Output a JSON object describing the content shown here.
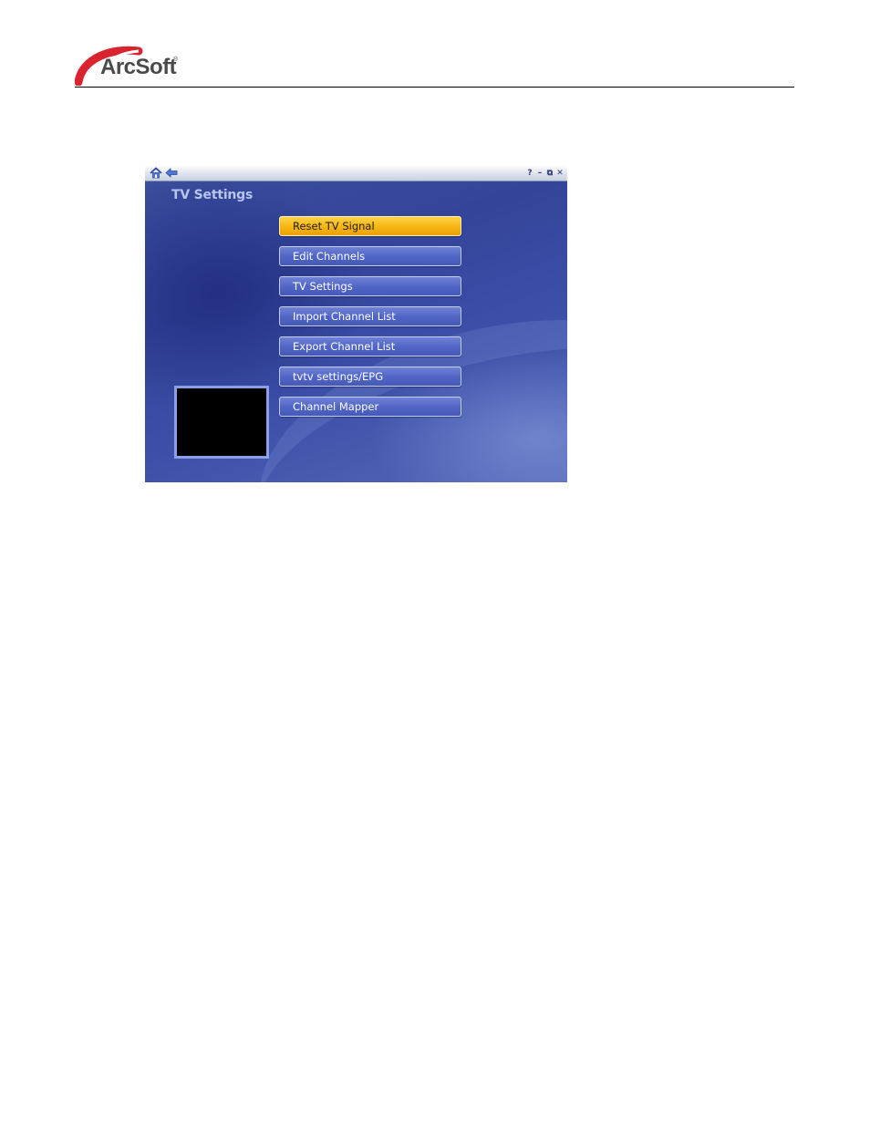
{
  "document": {
    "logo": {
      "text": "ArcSoft",
      "registered_mark": "®",
      "accent_color": "#d9232e"
    }
  },
  "window": {
    "title_bar": {
      "left_icons": [
        "home-icon",
        "back-arrow-icon"
      ],
      "right_buttons": {
        "help": "?",
        "minimize": "–",
        "restore": "⧉",
        "close": "✕"
      }
    },
    "page_title": "TV Settings",
    "menu": [
      {
        "label": "Reset TV Signal",
        "state": "selected"
      },
      {
        "label": "Edit Channels",
        "state": "normal"
      },
      {
        "label": "TV Settings",
        "state": "normal"
      },
      {
        "label": "Import Channel List",
        "state": "normal"
      },
      {
        "label": "Export Channel List",
        "state": "normal"
      },
      {
        "label": "tvtv settings/EPG",
        "state": "normal"
      },
      {
        "label": "Channel Mapper",
        "state": "normal"
      }
    ],
    "colors": {
      "background": "#3d4f9e",
      "button": "#5166c6",
      "button_selected": "#f6b814",
      "title_text": "#b7c4ee"
    }
  }
}
